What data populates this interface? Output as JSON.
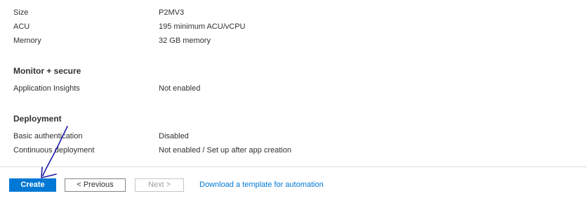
{
  "plan_rows": [
    {
      "key": "Size",
      "value": "P2MV3"
    },
    {
      "key": "ACU",
      "value": "195 minimum ACU/vCPU"
    },
    {
      "key": "Memory",
      "value": "32 GB memory"
    }
  ],
  "monitor_section": {
    "title": "Monitor + secure",
    "rows": [
      {
        "key": "Application Insights",
        "value": "Not enabled"
      }
    ]
  },
  "deployment_section": {
    "title": "Deployment",
    "rows": [
      {
        "key": "Basic authentication",
        "value": "Disabled"
      },
      {
        "key": "Continuous deployment",
        "value": "Not enabled / Set up after app creation"
      }
    ]
  },
  "footer": {
    "create_label": "Create",
    "previous_label": "< Previous",
    "next_label": "Next >",
    "template_link": "Download a template for automation"
  },
  "colors": {
    "primary": "#0078d4",
    "annotation_ink": "#1a1aa6"
  }
}
